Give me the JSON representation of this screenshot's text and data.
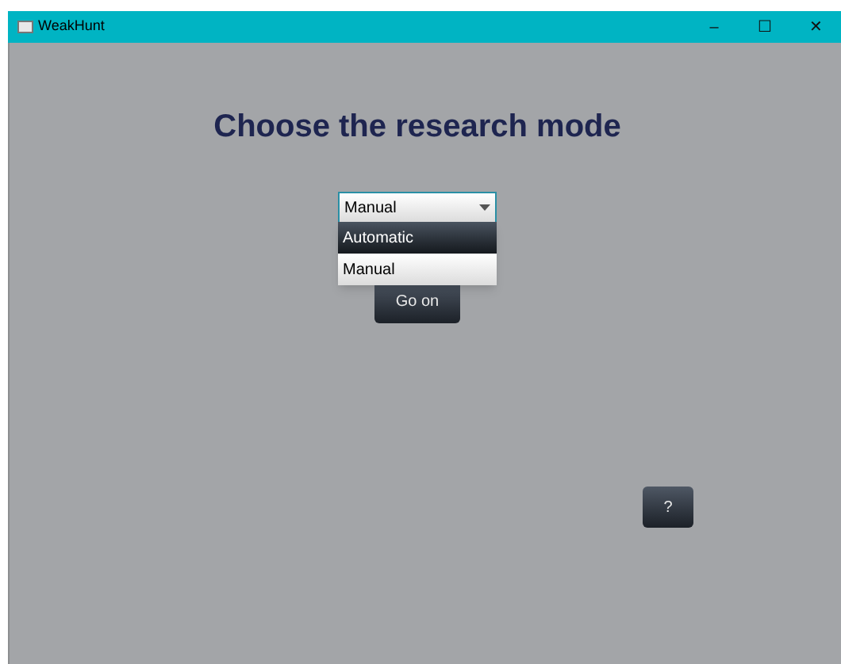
{
  "window": {
    "title": "WeakHunt",
    "controls": [
      "–",
      "☐",
      "✕"
    ]
  },
  "heading": "Choose the research mode",
  "mode_select": {
    "value": "Manual",
    "expanded": true,
    "options": [
      {
        "label": "Automatic",
        "highlighted": true
      },
      {
        "label": "Manual",
        "highlighted": false
      }
    ]
  },
  "go_button": "Go on",
  "help_button": "?"
}
